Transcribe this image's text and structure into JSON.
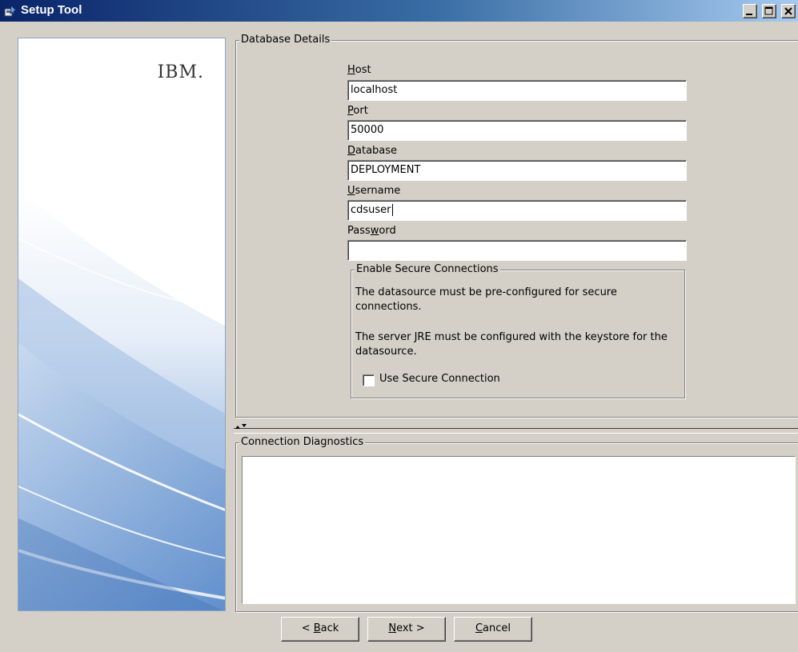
{
  "window": {
    "title": "Setup Tool"
  },
  "banner": {
    "logo_text": "IBM."
  },
  "database_details": {
    "legend": "Database Details",
    "fields": [
      {
        "label": "Host",
        "mnemonic": "H",
        "value": "localhost"
      },
      {
        "label": "Port",
        "mnemonic": "P",
        "value": "50000"
      },
      {
        "label": "Database",
        "mnemonic": "D",
        "value": "DEPLOYMENT"
      },
      {
        "label": "Username",
        "mnemonic": "U",
        "value": "cdsuser"
      },
      {
        "label": "Password",
        "mnemonic": "w",
        "value": ""
      }
    ],
    "secure": {
      "legend": "Enable Secure Connections",
      "text1": "The datasource must be pre-configured for secure connections.",
      "text2": "The server JRE must be configured with the keystore for the datasource.",
      "checkbox_label": "Use Secure Connection",
      "checked": false
    }
  },
  "diagnostics": {
    "legend": "Connection Diagnostics",
    "output": ""
  },
  "buttons": {
    "back": {
      "prefix": "< ",
      "mnemonic": "B",
      "rest": "ack"
    },
    "next": {
      "prefix": "",
      "mnemonic": "N",
      "rest": "ext >"
    },
    "cancel": {
      "prefix": "",
      "mnemonic": "C",
      "rest": "ancel"
    }
  },
  "icons": [
    "app-icon",
    "minimize-icon",
    "maximize-icon",
    "close-icon",
    "splitter-arrows-icon"
  ]
}
